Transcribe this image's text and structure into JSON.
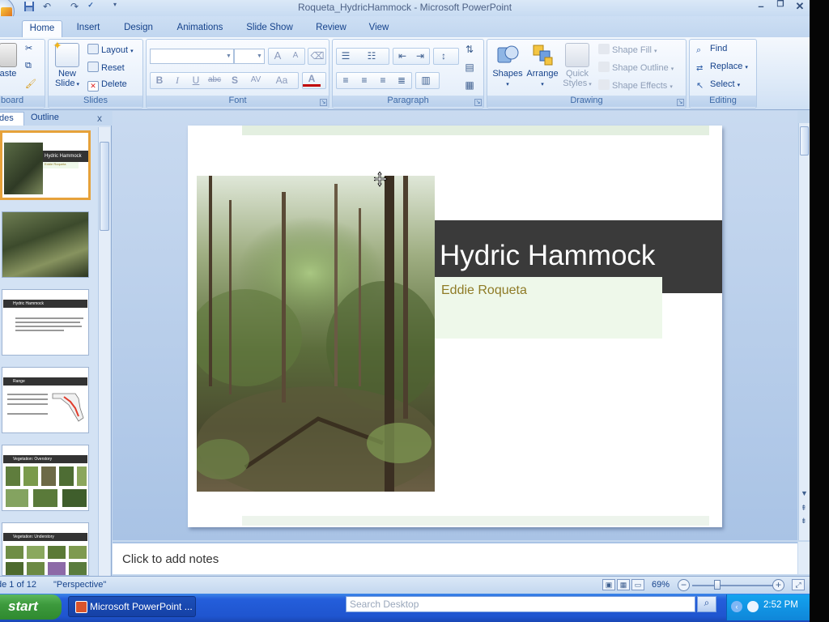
{
  "window": {
    "title": "Roqueta_HydricHammock - Microsoft PowerPoint",
    "controls": [
      "minimize",
      "restore",
      "close"
    ]
  },
  "quick_access": [
    "save-icon",
    "undo-icon",
    "redo-icon",
    "spelling-icon",
    "customize-arrow-icon"
  ],
  "tabs": [
    {
      "label": "Home",
      "active": true
    },
    {
      "label": "Insert",
      "active": false
    },
    {
      "label": "Design",
      "active": false
    },
    {
      "label": "Animations",
      "active": false
    },
    {
      "label": "Slide Show",
      "active": false
    },
    {
      "label": "Review",
      "active": false
    },
    {
      "label": "View",
      "active": false
    }
  ],
  "ribbon": {
    "clipboard": {
      "label": "board",
      "paste": "aste"
    },
    "slides": {
      "label": "Slides",
      "new_slide": "New",
      "new_slide2": "Slide",
      "layout": "Layout",
      "reset": "Reset",
      "delete": "Delete"
    },
    "font": {
      "label": "Font",
      "bold": "B",
      "italic": "I",
      "underline": "U",
      "strike": "abc",
      "shadow": "S",
      "spacing": "AV",
      "case": "Aa",
      "color": "A",
      "grow": "A",
      "shrink": "A"
    },
    "paragraph": {
      "label": "Paragraph"
    },
    "drawing": {
      "label": "Drawing",
      "shapes": "Shapes",
      "arrange": "Arrange",
      "quick_styles": "Quick",
      "quick_styles2": "Styles",
      "shape_fill": "Shape Fill",
      "shape_outline": "Shape Outline",
      "shape_effects": "Shape Effects"
    },
    "editing": {
      "label": "Editing",
      "find": "Find",
      "replace": "Replace",
      "select": "Select"
    }
  },
  "left_pane": {
    "tabs": [
      {
        "label": "des",
        "active": true
      },
      {
        "label": "Outline",
        "active": false
      }
    ],
    "close": "x",
    "thumbnails": [
      {
        "index": 1,
        "title": "Hydric Hammock",
        "subtitle": "Eddie Roqueta",
        "selected": true
      },
      {
        "index": 2,
        "title": "",
        "selected": false
      },
      {
        "index": 3,
        "title": "Hydric Hammock",
        "selected": false
      },
      {
        "index": 4,
        "title": "Range",
        "selected": false
      },
      {
        "index": 5,
        "title": "Vegetation: Overstory",
        "selected": false
      },
      {
        "index": 6,
        "title": "Vegetation: Understory",
        "selected": false
      }
    ]
  },
  "slide": {
    "title": "Hydric Hammock",
    "subtitle": "Eddie Roqueta",
    "photo_alt": "forest-photo"
  },
  "notes": {
    "placeholder": "Click to add notes"
  },
  "status": {
    "slide_info": "de 1 of 12",
    "theme": "\"Perspective\"",
    "zoom": "69%"
  },
  "taskbar": {
    "start": "start",
    "task_label": "Microsoft PowerPoint ...",
    "search_placeholder": "Search Desktop",
    "time": "2:52 PM"
  },
  "colors": {
    "slide_title_band": "#3a3a3a",
    "subtitle_text": "#8f7b26",
    "taskbar": "#245edb",
    "thumbnail_selected": "#e6a23b"
  }
}
